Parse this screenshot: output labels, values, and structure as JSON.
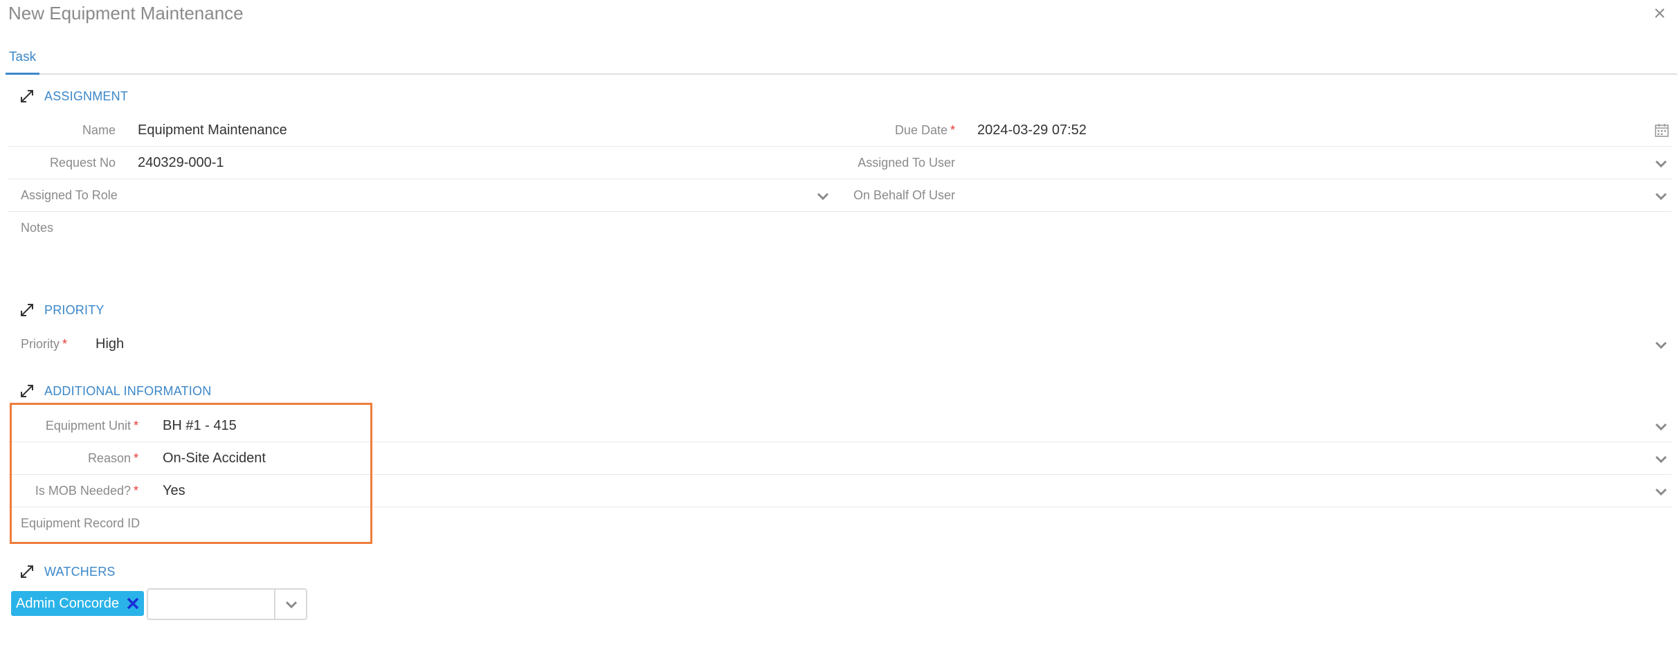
{
  "window": {
    "title": "New Equipment Maintenance"
  },
  "tabs": [
    {
      "label": "Task"
    }
  ],
  "assignment": {
    "title": "ASSIGNMENT",
    "name_label": "Name",
    "name_value": "Equipment Maintenance",
    "request_no_label": "Request No",
    "request_no_value": "240329-000-1",
    "assigned_role_label": "Assigned To Role",
    "assigned_role_value": "",
    "notes_label": "Notes",
    "notes_value": "",
    "due_date_label": "Due Date",
    "due_date_value": "2024-03-29 07:52",
    "assigned_user_label": "Assigned To User",
    "assigned_user_value": "",
    "on_behalf_label": "On Behalf Of User",
    "on_behalf_value": ""
  },
  "priority": {
    "title": "PRIORITY",
    "label": "Priority",
    "value": "High"
  },
  "additional": {
    "title": "ADDITIONAL INFORMATION",
    "equipment_unit_label": "Equipment Unit",
    "equipment_unit_value": "BH #1 - 415",
    "reason_label": "Reason",
    "reason_value": "On-Site Accident",
    "mob_label": "Is MOB Needed?",
    "mob_value": "Yes",
    "record_id_label": "Equipment Record ID",
    "record_id_value": ""
  },
  "watchers": {
    "title": "WATCHERS",
    "chips": [
      {
        "label": "Admin Concorde"
      }
    ],
    "input_value": ""
  },
  "required_marker": "*",
  "colors": {
    "accent": "#3b87c9",
    "required": "#e53935",
    "highlight": "#ee7d3b",
    "chip_bg": "#2ab3e8",
    "chip_remove": "#1a2fd6"
  },
  "icons": {
    "close": "close-icon",
    "section": "collapse-arrows-icon",
    "dropdown": "chevron-down-icon",
    "calendar": "calendar-icon",
    "remove": "remove-x-icon"
  }
}
